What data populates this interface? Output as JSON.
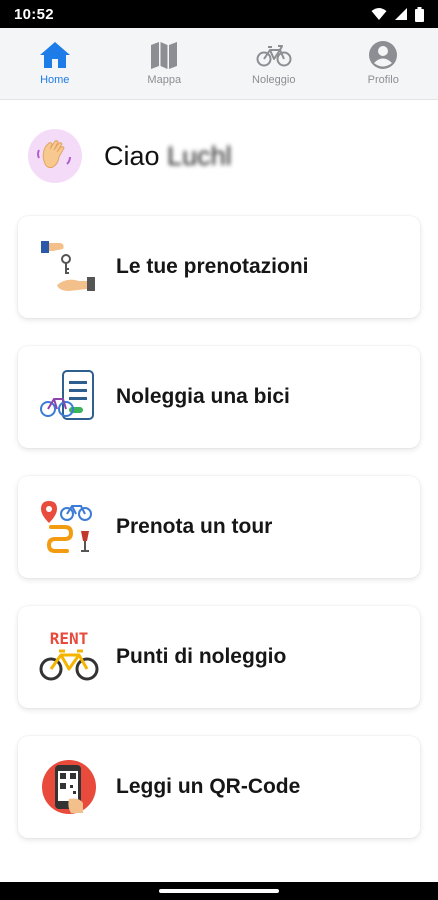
{
  "status": {
    "time": "10:52",
    "icons": [
      "wifi-icon",
      "signal-icon",
      "battery-icon"
    ]
  },
  "tabs": [
    {
      "label": "Home",
      "icon": "home-icon",
      "active": true
    },
    {
      "label": "Mappa",
      "icon": "map-icon",
      "active": false
    },
    {
      "label": "Noleggio",
      "icon": "bicycle-icon",
      "active": false
    },
    {
      "label": "Profilo",
      "icon": "account-icon",
      "active": false
    }
  ],
  "colors": {
    "accent": "#1e7ce8",
    "inactive": "#8d8e93",
    "tabbar_bg": "#f4f5f7"
  },
  "greeting": {
    "prefix": "Ciao",
    "name": "Luchl"
  },
  "menu": [
    {
      "label": "Le tue prenotazioni",
      "icon": "key-handover-icon"
    },
    {
      "label": "Noleggia una bici",
      "icon": "bike-phone-icon"
    },
    {
      "label": "Prenota un tour",
      "icon": "tour-route-icon"
    },
    {
      "label": "Punti di noleggio",
      "icon": "rent-bike-icon"
    },
    {
      "label": "Leggi un QR-Code",
      "icon": "qr-scan-icon"
    }
  ]
}
